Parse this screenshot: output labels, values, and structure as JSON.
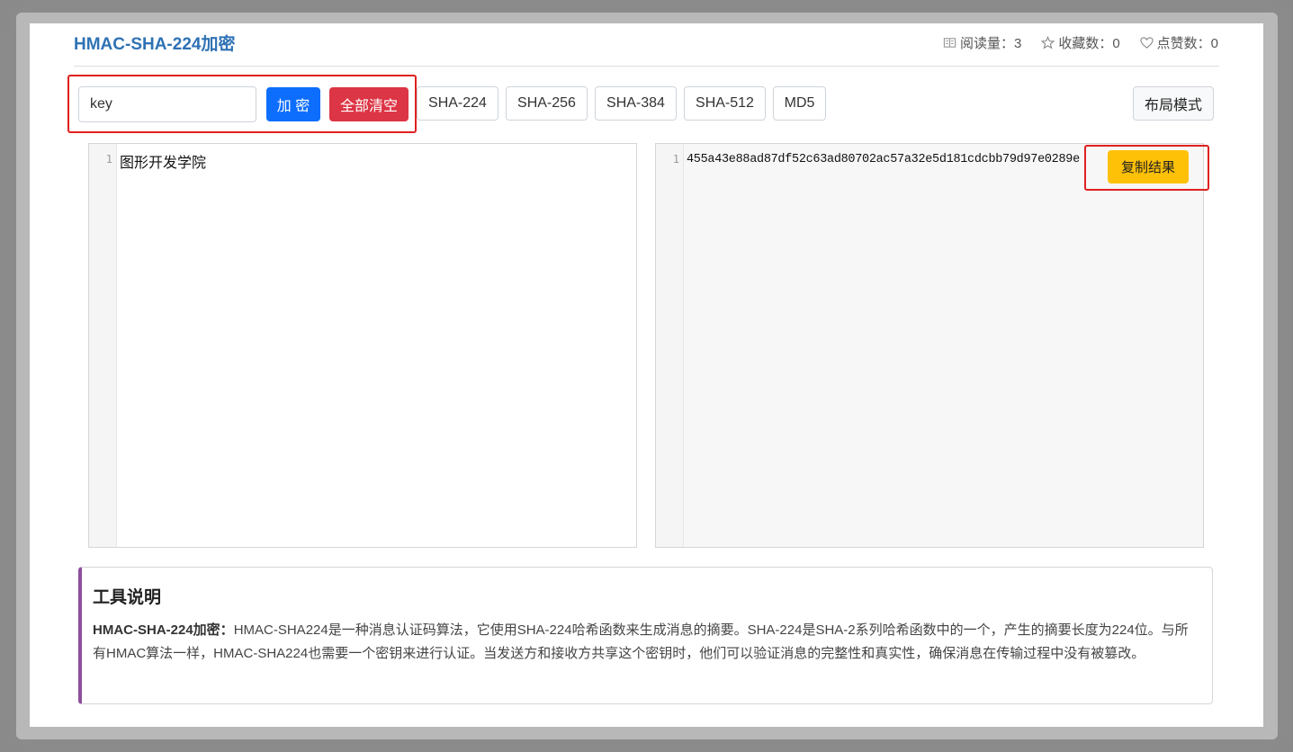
{
  "header": {
    "title": "HMAC-SHA-224加密",
    "stats": {
      "reads": "阅读量：3",
      "favorites": "收藏数：0",
      "likes": "点赞数：0"
    }
  },
  "toolbar": {
    "key_value": "key",
    "encrypt_label": "加 密",
    "clear_label": "全部清空",
    "algorithms": [
      "SHA-224",
      "SHA-256",
      "SHA-384",
      "SHA-512",
      "MD5"
    ],
    "layout_label": "布局模式"
  },
  "input_editor": {
    "line_number": "1",
    "content": "图形开发学院"
  },
  "output_editor": {
    "line_number": "1",
    "content": "455a43e88ad87df52c63ad80702ac57a32e5d181cdcbb79d97e0289e",
    "copy_label": "复制结果"
  },
  "description": {
    "heading": "工具说明",
    "term": "HMAC-SHA-224加密：",
    "text": "HMAC-SHA224是一种消息认证码算法，它使用SHA-224哈希函数来生成消息的摘要。SHA-224是SHA-2系列哈希函数中的一个，产生的摘要长度为224位。与所有HMAC算法一样，HMAC-SHA224也需要一个密钥来进行认证。当发送方和接收方共享这个密钥时，他们可以验证消息的完整性和真实性，确保消息在传输过程中没有被篡改。"
  },
  "colors": {
    "title": "#2f72b4",
    "encrypt": "#0d6efd",
    "clear": "#dc3545",
    "copy": "#ffc107",
    "highlight_box": "#e02020",
    "desc_accent": "#8e4f9c"
  },
  "icons": {
    "reads": "book-icon",
    "favorites": "star-icon",
    "likes": "heart-icon"
  }
}
